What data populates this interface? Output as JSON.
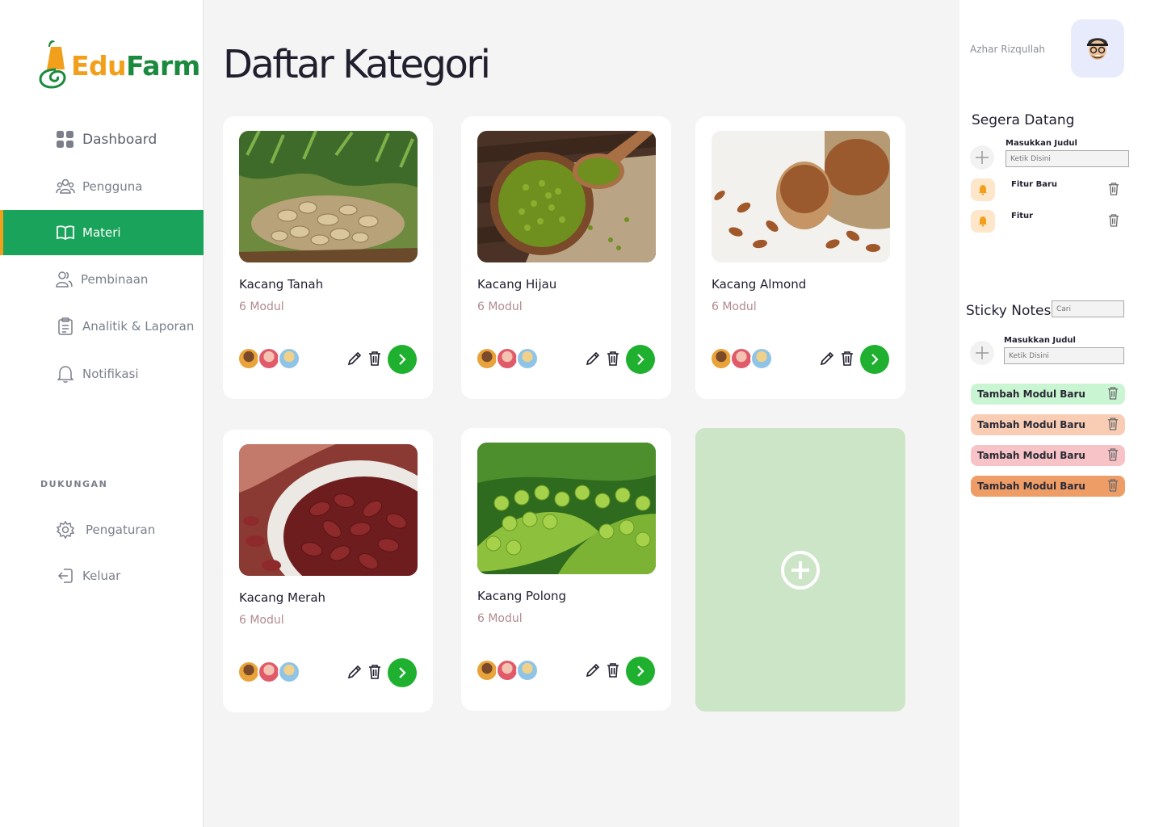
{
  "app": {
    "logo_edu": "Edu",
    "logo_farm": "Farm"
  },
  "sidebar": {
    "items": [
      {
        "label": "Dashboard",
        "icon": "dashboard-grid-icon"
      },
      {
        "label": "Pengguna",
        "icon": "users-icon"
      },
      {
        "label": "Materi",
        "icon": "book-icon",
        "active": true
      },
      {
        "label": "Pembinaan",
        "icon": "people-icon"
      },
      {
        "label": "Analitik & Laporan",
        "icon": "clipboard-icon"
      },
      {
        "label": "Notifikasi",
        "icon": "bell-icon"
      }
    ],
    "support_label": "DUKUNGAN",
    "support_items": [
      {
        "label": "Pengaturan",
        "icon": "gear-icon"
      },
      {
        "label": "Keluar",
        "icon": "logout-icon"
      }
    ]
  },
  "main": {
    "title": "Daftar Kategori",
    "categories": [
      {
        "name": "Kacang Tanah",
        "modules": "6 Modul"
      },
      {
        "name": "Kacang Hijau",
        "modules": "6 Modul"
      },
      {
        "name": "Kacang Almond",
        "modules": "6 Modul"
      },
      {
        "name": "Kacang Merah",
        "modules": "6 Modul"
      },
      {
        "name": "Kacang Polong",
        "modules": "6 Modul"
      }
    ],
    "colors": {
      "accent": "#1aa35a",
      "go_button": "#1fb030",
      "add_card": "#cce5c6"
    }
  },
  "rightpanel": {
    "user_name": "Azhar Rizqullah",
    "coming_soon": {
      "title": "Segera Datang",
      "input_label": "Masukkan Judul",
      "input_placeholder": "Ketik Disini",
      "items": [
        "Fitur Baru",
        "Fitur"
      ]
    },
    "sticky": {
      "title": "Sticky Notes",
      "search_placeholder": "Cari",
      "input_label": "Masukkan Judul",
      "input_placeholder": "Ketik Disini",
      "notes": [
        {
          "label": "Tambah Modul Baru",
          "color": "#c9f5d2"
        },
        {
          "label": "Tambah Modul Baru",
          "color": "#f8cdb4"
        },
        {
          "label": "Tambah Modul Baru",
          "color": "#f7c3c6"
        },
        {
          "label": "Tambah Modul Baru",
          "color": "#ef9d67"
        }
      ]
    }
  }
}
